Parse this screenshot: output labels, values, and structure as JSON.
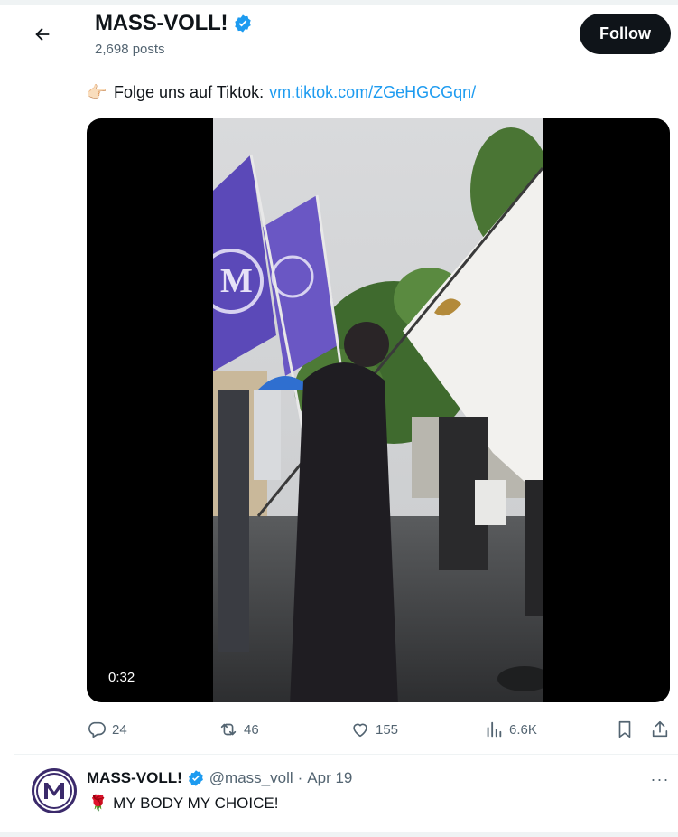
{
  "header": {
    "title": "MASS-VOLL!",
    "post_count": "2,698 posts",
    "follow_label": "Follow"
  },
  "tweet": {
    "text_prefix": "Folge uns auf Tiktok:",
    "link_text": "vm.tiktok.com/ZGeHGCGqn/",
    "video_duration": "0:32"
  },
  "actions": {
    "replies": "24",
    "reposts": "46",
    "likes": "155",
    "views": "6.6K"
  },
  "reply": {
    "name": "MASS-VOLL!",
    "handle": "@mass_voll",
    "separator": "·",
    "date": "Apr 19",
    "text": "MY BODY MY CHOICE!"
  },
  "colors": {
    "accent": "#1d9bf0",
    "text": "#0f1419",
    "muted": "#536471",
    "follow_bg": "#0f1419",
    "flag_purple": "#5b49b8",
    "avatar_purple": "#3b2a6b"
  },
  "icons": {
    "back": "arrow-left-icon",
    "verified": "verified-badge-icon",
    "point": "backhand-index-pointing-right-emoji",
    "reply": "reply-bubble-icon",
    "repost": "repost-icon",
    "like": "heart-icon",
    "views": "views-bar-chart-icon",
    "bookmark": "bookmark-icon",
    "share": "share-icon",
    "rose": "rose-emoji",
    "more": "more-dots-icon"
  }
}
